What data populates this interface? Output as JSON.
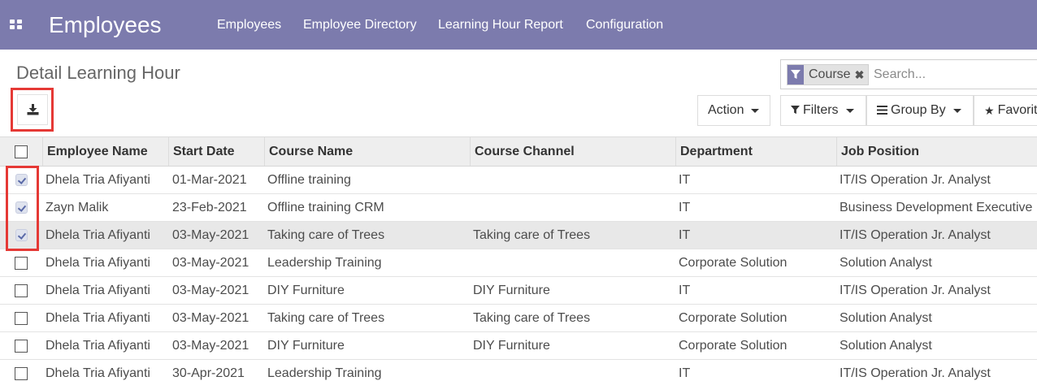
{
  "navbar": {
    "brand": "Employees",
    "menu": [
      {
        "label": "Employees"
      },
      {
        "label": "Employee Directory"
      },
      {
        "label": "Learning Hour Report"
      },
      {
        "label": "Configuration"
      }
    ]
  },
  "page": {
    "title": "Detail Learning Hour"
  },
  "search": {
    "facet_label": "Course",
    "placeholder": "Search..."
  },
  "toolbar": {
    "action_label": "Action",
    "filters_label": "Filters",
    "group_by_label": "Group By",
    "favorites_label": "Favorites"
  },
  "table": {
    "columns": [
      "Employee Name",
      "Start Date",
      "Course Name",
      "Course Channel",
      "Department",
      "Job Position"
    ],
    "rows": [
      {
        "checked": true,
        "employee": "Dhela Tria Afiyanti",
        "start_date": "01-Mar-2021",
        "course": "Offline training",
        "channel": "",
        "department": "IT",
        "job": "IT/IS Operation Jr. Analyst"
      },
      {
        "checked": true,
        "employee": "Zayn Malik",
        "start_date": "23-Feb-2021",
        "course": "Offline training CRM",
        "channel": "",
        "department": "IT",
        "job": "Business Development Executive"
      },
      {
        "checked": true,
        "employee": "Dhela Tria Afiyanti",
        "start_date": "03-May-2021",
        "course": "Taking care of Trees",
        "channel": "Taking care of Trees",
        "department": "IT",
        "job": "IT/IS Operation Jr. Analyst"
      },
      {
        "checked": false,
        "employee": "Dhela Tria Afiyanti",
        "start_date": "03-May-2021",
        "course": "Leadership Training",
        "channel": "",
        "department": "Corporate Solution",
        "job": "Solution Analyst"
      },
      {
        "checked": false,
        "employee": "Dhela Tria Afiyanti",
        "start_date": "03-May-2021",
        "course": "DIY Furniture",
        "channel": "DIY Furniture",
        "department": "IT",
        "job": "IT/IS Operation Jr. Analyst"
      },
      {
        "checked": false,
        "employee": "Dhela Tria Afiyanti",
        "start_date": "03-May-2021",
        "course": "Taking care of Trees",
        "channel": "Taking care of Trees",
        "department": "Corporate Solution",
        "job": "Solution Analyst"
      },
      {
        "checked": false,
        "employee": "Dhela Tria Afiyanti",
        "start_date": "03-May-2021",
        "course": "DIY Furniture",
        "channel": "DIY Furniture",
        "department": "Corporate Solution",
        "job": "Solution Analyst"
      },
      {
        "checked": false,
        "employee": "Dhela Tria Afiyanti",
        "start_date": "30-Apr-2021",
        "course": "Leadership Training",
        "channel": "",
        "department": "IT",
        "job": "IT/IS Operation Jr. Analyst"
      }
    ]
  },
  "colors": {
    "navbar": "#7c7bad",
    "highlight_frame": "#e53935"
  }
}
